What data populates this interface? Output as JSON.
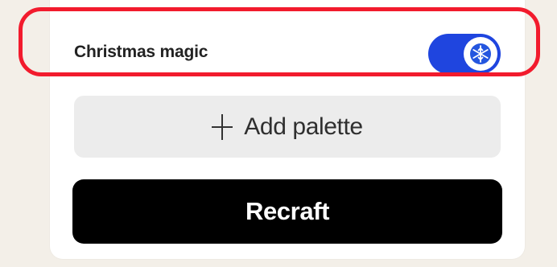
{
  "settings": {
    "christmas_magic": {
      "label": "Christmas magic",
      "enabled": true,
      "icon": "snowflake-icon",
      "accent": "#1f45df"
    }
  },
  "actions": {
    "add_palette": {
      "label": "Add palette",
      "icon": "plus-icon"
    },
    "recraft": {
      "label": "Recraft"
    }
  },
  "annotation": {
    "highlight_color": "#f21b2d"
  }
}
